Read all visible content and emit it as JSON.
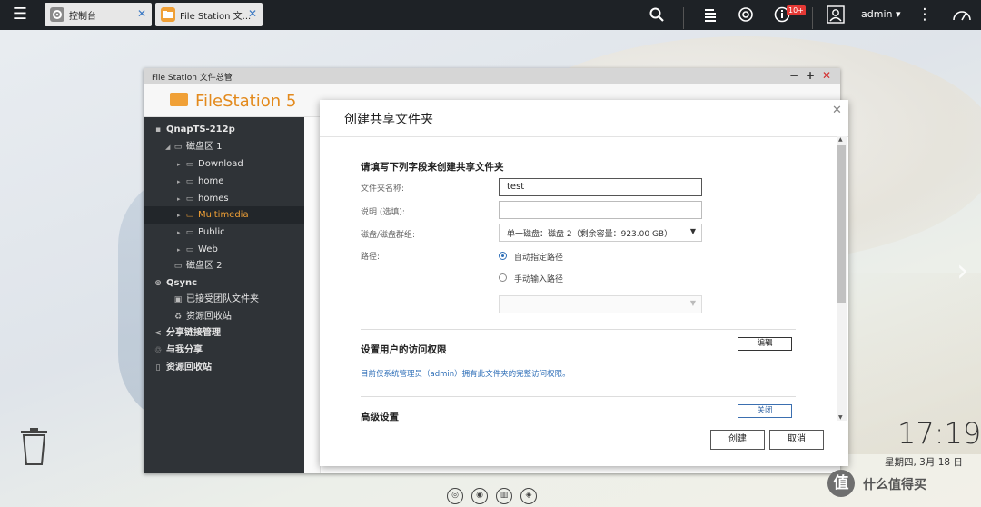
{
  "topbar": {
    "tabs": [
      {
        "label": "控制台",
        "icon": "gear-icon",
        "color": "#8a8a8a"
      },
      {
        "label": "File Station 文...",
        "icon": "folder-icon",
        "color": "#f0a036"
      }
    ],
    "badge": "10+",
    "user": "admin ▾"
  },
  "filestation": {
    "window_title": "File Station 文件总管",
    "logo_text": "FileStation 5",
    "tree": [
      {
        "label": "QnapTS-212p",
        "level": 0
      },
      {
        "label": "磁盘区 1",
        "level": 1
      },
      {
        "label": "Download",
        "level": 2
      },
      {
        "label": "home",
        "level": 2
      },
      {
        "label": "homes",
        "level": 2
      },
      {
        "label": "Multimedia",
        "level": 2,
        "selected": true
      },
      {
        "label": "Public",
        "level": 2
      },
      {
        "label": "Web",
        "level": 2
      },
      {
        "label": "磁盘区 2",
        "level": 1
      },
      {
        "label": "Qsync",
        "level": 0
      },
      {
        "label": "已接受团队文件夹",
        "level": 1
      },
      {
        "label": "资源回收站",
        "level": 1
      },
      {
        "label": "分享链接管理",
        "level": 0
      },
      {
        "label": "与我分享",
        "level": 0
      },
      {
        "label": "资源回收站",
        "level": 0
      }
    ]
  },
  "dialog": {
    "title": "创建共享文件夹",
    "section1": "请填写下列字段来创建共享文件夹",
    "folder_name_label": "文件夹名称:",
    "folder_name_value": "test",
    "desc_label": "说明 (选填):",
    "desc_value": "",
    "disk_label": "磁盘/磁盘群组:",
    "disk_value": "单一磁盘：磁盘 2（剩余容量：923.00 GB）",
    "path_label": "路径:",
    "path_auto": "自动指定路径",
    "path_manual": "手动输入路径",
    "section2": "设置用户的访问权限",
    "edit_button": "编辑",
    "access_info": "目前仅系统管理员（admin）拥有此文件夹的完整访问权限。",
    "section3": "高级设置",
    "close_button": "关闭",
    "create_button": "创建",
    "cancel_button": "取消"
  },
  "desktop": {
    "time": "17:19",
    "date": "星期四, 3月 18 日"
  },
  "watermark": {
    "mark": "值",
    "text": "什么值得买"
  }
}
